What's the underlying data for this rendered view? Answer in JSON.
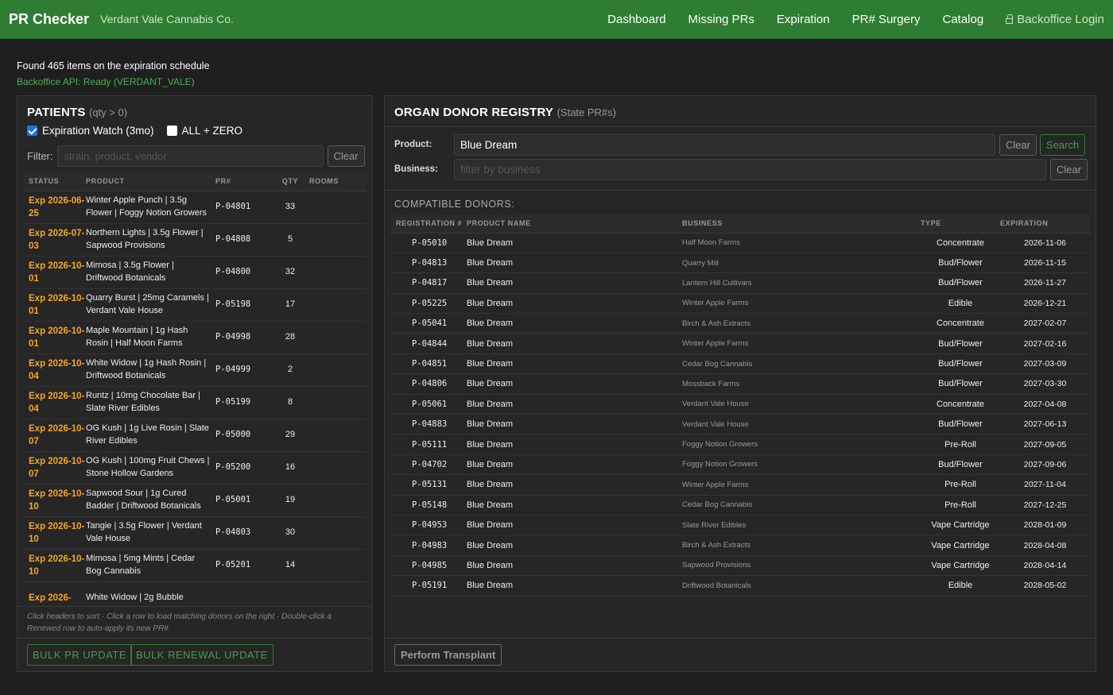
{
  "header": {
    "brand": "PR Checker",
    "company": "Verdant Vale Cannabis Co.",
    "nav": [
      "Dashboard",
      "Missing PRs",
      "Expiration",
      "PR# Surgery",
      "Catalog"
    ],
    "login": "Backoffice Login"
  },
  "status": {
    "found": "Found 465 items on the expiration schedule",
    "api": "Backoffice API: Ready (VERDANT_VALE)"
  },
  "patients": {
    "title": "PATIENTS",
    "subtitle": "(qty > 0)",
    "check_watch": "Expiration Watch (3mo)",
    "check_all": "ALL + ZERO",
    "filter_label": "Filter:",
    "filter_placeholder": "strain, product, vendor",
    "clear": "Clear",
    "columns": [
      "STATUS",
      "PRODUCT",
      "PR#",
      "QTY",
      "ROOMS"
    ],
    "rows": [
      {
        "status": "Exp 2026-06-25",
        "product": "Winter Apple Punch | 3.5g Flower | Foggy Notion Growers",
        "pr": "P-04801",
        "qty": "33",
        "rooms": ""
      },
      {
        "status": "Exp 2026-07-03",
        "product": "Northern Lights | 3.5g Flower | Sapwood Provisions",
        "pr": "P-04808",
        "qty": "5",
        "rooms": ""
      },
      {
        "status": "Exp 2026-10-01",
        "product": "Mimosa | 3.5g Flower | Driftwood Botanicals",
        "pr": "P-04800",
        "qty": "32",
        "rooms": ""
      },
      {
        "status": "Exp 2026-10-01",
        "product": "Quarry Burst | 25mg Caramels | Verdant Vale House",
        "pr": "P-05198",
        "qty": "17",
        "rooms": ""
      },
      {
        "status": "Exp 2026-10-01",
        "product": "Maple Mountain | 1g Hash Rosin | Half Moon Farms",
        "pr": "P-04998",
        "qty": "28",
        "rooms": ""
      },
      {
        "status": "Exp 2026-10-04",
        "product": "White Widow | 1g Hash Rosin | Driftwood Botanicals",
        "pr": "P-04999",
        "qty": "2",
        "rooms": ""
      },
      {
        "status": "Exp 2026-10-04",
        "product": "Runtz | 10mg Chocolate Bar | Slate River Edibles",
        "pr": "P-05199",
        "qty": "8",
        "rooms": ""
      },
      {
        "status": "Exp 2026-10-07",
        "product": "OG Kush | 1g Live Rosin | Slate River Edibles",
        "pr": "P-05000",
        "qty": "29",
        "rooms": ""
      },
      {
        "status": "Exp 2026-10-07",
        "product": "OG Kush | 100mg Fruit Chews | Stone Hollow Gardens",
        "pr": "P-05200",
        "qty": "16",
        "rooms": ""
      },
      {
        "status": "Exp 2026-10-10",
        "product": "Sapwood Sour | 1g Cured Badder | Driftwood Botanicals",
        "pr": "P-05001",
        "qty": "19",
        "rooms": ""
      },
      {
        "status": "Exp 2026-10-10",
        "product": "Tangie | 3.5g Flower | Verdant Vale House",
        "pr": "P-04803",
        "qty": "30",
        "rooms": ""
      },
      {
        "status": "Exp 2026-10-10",
        "product": "Mimosa | 5mg Mints | Cedar Bog Cannabis",
        "pr": "P-05201",
        "qty": "14",
        "rooms": ""
      },
      {
        "status": "Exp 2026-",
        "product": "White Widow | 2g Bubble",
        "pr": "",
        "qty": "",
        "rooms": ""
      }
    ],
    "hint": "Click headers to sort · Click a row to load matching donors on the right · Double-click a Renewed row to auto-apply its new PR#",
    "bulk_pr": "BULK PR UPDATE",
    "bulk_renewal": "BULK RENEWAL UPDATE"
  },
  "donors": {
    "title": "ORGAN DONOR REGISTRY",
    "subtitle": "(State PR#s)",
    "product_label": "Product:",
    "product_value": "Blue Dream",
    "business_label": "Business:",
    "business_placeholder": "filter by business",
    "clear": "Clear",
    "search": "Search",
    "compatible": "COMPATIBLE DONORS:",
    "columns": [
      "REGISTRATION #",
      "PRODUCT NAME",
      "BUSINESS",
      "TYPE",
      "EXPIRATION"
    ],
    "rows": [
      {
        "reg": "P-05010",
        "name": "Blue Dream",
        "business": "Half Moon Farms",
        "type": "Concentrate",
        "exp": "2026-11-06"
      },
      {
        "reg": "P-04813",
        "name": "Blue Dream",
        "business": "Quarry Mill",
        "type": "Bud/Flower",
        "exp": "2026-11-15"
      },
      {
        "reg": "P-04817",
        "name": "Blue Dream",
        "business": "Lantern Hill Cultivars",
        "type": "Bud/Flower",
        "exp": "2026-11-27"
      },
      {
        "reg": "P-05225",
        "name": "Blue Dream",
        "business": "Winter Apple Farms",
        "type": "Edible",
        "exp": "2026-12-21"
      },
      {
        "reg": "P-05041",
        "name": "Blue Dream",
        "business": "Birch & Ash Extracts",
        "type": "Concentrate",
        "exp": "2027-02-07"
      },
      {
        "reg": "P-04844",
        "name": "Blue Dream",
        "business": "Winter Apple Farms",
        "type": "Bud/Flower",
        "exp": "2027-02-16"
      },
      {
        "reg": "P-04851",
        "name": "Blue Dream",
        "business": "Cedar Bog Cannabis",
        "type": "Bud/Flower",
        "exp": "2027-03-09"
      },
      {
        "reg": "P-04806",
        "name": "Blue Dream",
        "business": "Mossback Farms",
        "type": "Bud/Flower",
        "exp": "2027-03-30"
      },
      {
        "reg": "P-05061",
        "name": "Blue Dream",
        "business": "Verdant Vale House",
        "type": "Concentrate",
        "exp": "2027-04-08"
      },
      {
        "reg": "P-04883",
        "name": "Blue Dream",
        "business": "Verdant Vale House",
        "type": "Bud/Flower",
        "exp": "2027-06-13"
      },
      {
        "reg": "P-05111",
        "name": "Blue Dream",
        "business": "Foggy Notion Growers",
        "type": "Pre-Roll",
        "exp": "2027-09-05"
      },
      {
        "reg": "P-04702",
        "name": "Blue Dream",
        "business": "Foggy Notion Growers",
        "type": "Bud/Flower",
        "exp": "2027-09-06"
      },
      {
        "reg": "P-05131",
        "name": "Blue Dream",
        "business": "Winter Apple Farms",
        "type": "Pre-Roll",
        "exp": "2027-11-04"
      },
      {
        "reg": "P-05148",
        "name": "Blue Dream",
        "business": "Cedar Bog Cannabis",
        "type": "Pre-Roll",
        "exp": "2027-12-25"
      },
      {
        "reg": "P-04953",
        "name": "Blue Dream",
        "business": "Slate River Edibles",
        "type": "Vape Cartridge",
        "exp": "2028-01-09"
      },
      {
        "reg": "P-04983",
        "name": "Blue Dream",
        "business": "Birch & Ash Extracts",
        "type": "Vape Cartridge",
        "exp": "2028-04-08"
      },
      {
        "reg": "P-04985",
        "name": "Blue Dream",
        "business": "Sapwood Provisions",
        "type": "Vape Cartridge",
        "exp": "2028-04-14"
      },
      {
        "reg": "P-05191",
        "name": "Blue Dream",
        "business": "Driftwood Botanicals",
        "type": "Edible",
        "exp": "2028-05-02"
      }
    ],
    "transplant": "Perform Transplant"
  }
}
